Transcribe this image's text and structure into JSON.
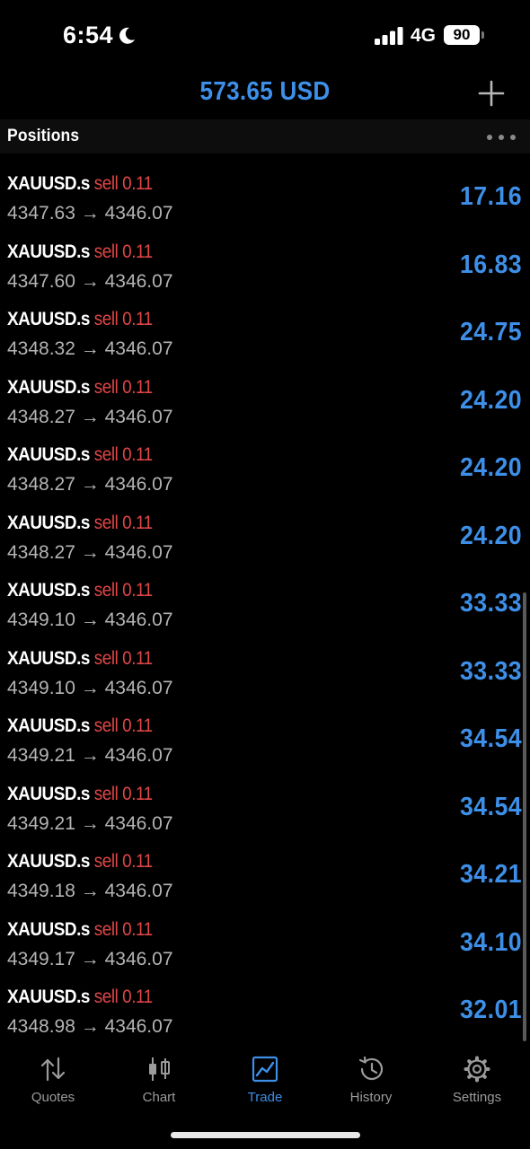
{
  "status_bar": {
    "time": "6:54",
    "network": "4G",
    "battery": "90"
  },
  "header": {
    "balance": "573.65 USD"
  },
  "section": {
    "title": "Positions"
  },
  "positions": [
    {
      "symbol": "XAUUSD.s",
      "side": "sell",
      "volume": "0.11",
      "open_price": "4347.63",
      "current_price": "4346.07",
      "profit": "17.16"
    },
    {
      "symbol": "XAUUSD.s",
      "side": "sell",
      "volume": "0.11",
      "open_price": "4347.60",
      "current_price": "4346.07",
      "profit": "16.83"
    },
    {
      "symbol": "XAUUSD.s",
      "side": "sell",
      "volume": "0.11",
      "open_price": "4348.32",
      "current_price": "4346.07",
      "profit": "24.75"
    },
    {
      "symbol": "XAUUSD.s",
      "side": "sell",
      "volume": "0.11",
      "open_price": "4348.27",
      "current_price": "4346.07",
      "profit": "24.20"
    },
    {
      "symbol": "XAUUSD.s",
      "side": "sell",
      "volume": "0.11",
      "open_price": "4348.27",
      "current_price": "4346.07",
      "profit": "24.20"
    },
    {
      "symbol": "XAUUSD.s",
      "side": "sell",
      "volume": "0.11",
      "open_price": "4348.27",
      "current_price": "4346.07",
      "profit": "24.20"
    },
    {
      "symbol": "XAUUSD.s",
      "side": "sell",
      "volume": "0.11",
      "open_price": "4349.10",
      "current_price": "4346.07",
      "profit": "33.33"
    },
    {
      "symbol": "XAUUSD.s",
      "side": "sell",
      "volume": "0.11",
      "open_price": "4349.10",
      "current_price": "4346.07",
      "profit": "33.33"
    },
    {
      "symbol": "XAUUSD.s",
      "side": "sell",
      "volume": "0.11",
      "open_price": "4349.21",
      "current_price": "4346.07",
      "profit": "34.54"
    },
    {
      "symbol": "XAUUSD.s",
      "side": "sell",
      "volume": "0.11",
      "open_price": "4349.21",
      "current_price": "4346.07",
      "profit": "34.54"
    },
    {
      "symbol": "XAUUSD.s",
      "side": "sell",
      "volume": "0.11",
      "open_price": "4349.18",
      "current_price": "4346.07",
      "profit": "34.21"
    },
    {
      "symbol": "XAUUSD.s",
      "side": "sell",
      "volume": "0.11",
      "open_price": "4349.17",
      "current_price": "4346.07",
      "profit": "34.10"
    },
    {
      "symbol": "XAUUSD.s",
      "side": "sell",
      "volume": "0.11",
      "open_price": "4348.98",
      "current_price": "4346.07",
      "profit": "32.01"
    }
  ],
  "tabs": [
    {
      "label": "Quotes",
      "icon": "quotes-arrows-icon",
      "active": false
    },
    {
      "label": "Chart",
      "icon": "candlestick-chart-icon",
      "active": false
    },
    {
      "label": "Trade",
      "icon": "trade-chart-icon",
      "active": true
    },
    {
      "label": "History",
      "icon": "history-clock-icon",
      "active": false
    },
    {
      "label": "Settings",
      "icon": "gear-icon",
      "active": false
    }
  ],
  "colors": {
    "accent": "#3d8fe8",
    "sell": "#e04646",
    "secondary_text": "#b4b4b4",
    "background": "#000000"
  }
}
